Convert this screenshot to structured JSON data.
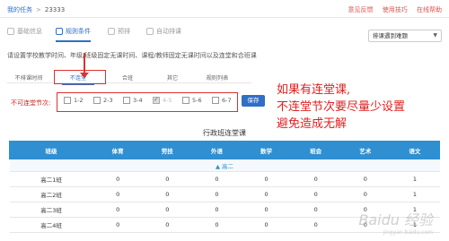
{
  "topbar": {
    "crumb_root": "我的任务",
    "crumb_sep": ">",
    "crumb_id": "23333",
    "links": [
      "意见反馈",
      "使用技巧",
      "在线帮助"
    ]
  },
  "tabs": [
    {
      "label": "基础信息"
    },
    {
      "label": "规则条件"
    },
    {
      "label": "预排"
    },
    {
      "label": "自动排课"
    }
  ],
  "rule_select": {
    "label": "排课遇到难题"
  },
  "description": "请设置学校教学时间、年级/班级固定无课时间、课程/教师固定无课时间以及连堂和合班课",
  "subtabs": [
    "不排课时间",
    "不连堂",
    "合班",
    "其它",
    "规则列表"
  ],
  "consecutive": {
    "label": "不可连堂节次:",
    "options": [
      {
        "label": "1-2",
        "checked": false,
        "disabled": false
      },
      {
        "label": "2-3",
        "checked": false,
        "disabled": false
      },
      {
        "label": "3-4",
        "checked": false,
        "disabled": false
      },
      {
        "label": "4-5",
        "checked": true,
        "disabled": true
      },
      {
        "label": "5-6",
        "checked": false,
        "disabled": false
      },
      {
        "label": "6-7",
        "checked": false,
        "disabled": false
      }
    ],
    "save_label": "保存"
  },
  "annotation": [
    "如果有连堂课,",
    "不连堂节次要尽量少设置",
    "避免造成无解"
  ],
  "table": {
    "title": "行政班连堂课",
    "headers": [
      "班级",
      "体育",
      "劳技",
      "外语",
      "数学",
      "班会",
      "艺术",
      "语文"
    ],
    "group_label": "高二",
    "rows": [
      [
        "高二1班",
        "0",
        "0",
        "0",
        "0",
        "0",
        "0",
        "1"
      ],
      [
        "高二2班",
        "0",
        "0",
        "0",
        "0",
        "0",
        "0",
        "1"
      ],
      [
        "高二3班",
        "0",
        "0",
        "0",
        "0",
        "0",
        "0",
        "1"
      ],
      [
        "高二4班",
        "0",
        "0",
        "0",
        "0",
        "0",
        "0",
        "1"
      ]
    ]
  },
  "watermark": {
    "main": "Baidu 经验",
    "sub": "jingyan.baidu.com"
  }
}
